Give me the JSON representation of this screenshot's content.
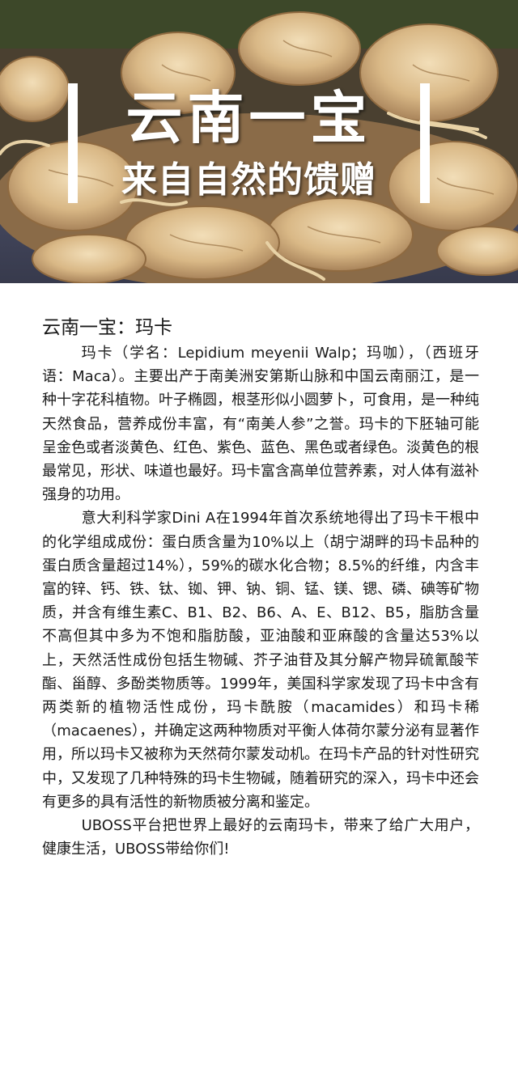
{
  "hero": {
    "image_alt": "maca-roots-photo",
    "banner_line1": "云南一宝",
    "banner_line2": "来自自然的馈赠"
  },
  "article": {
    "title": "云南一宝：玛卡",
    "paragraphs": [
      "玛卡（学名：Lepidium meyenii Walp；玛咖），（西班牙语：Maca）。主要出产于南美洲安第斯山脉和中国云南丽江，是一种十字花科植物。叶子椭圆，根茎形似小圆萝卜，可食用，是一种纯天然食品，营养成份丰富，有“南美人参”之誉。玛卡的下胚轴可能呈金色或者淡黄色、红色、紫色、蓝色、黑色或者绿色。淡黄色的根最常见，形状、味道也最好。玛卡富含高单位营养素，对人体有滋补强身的功用。",
      "意大利科学家Dini A在1994年首次系统地得出了玛卡干根中的化学组成成份：蛋白质含量为10%以上（胡宁湖畔的玛卡品种的蛋白质含量超过14%），59%的碳水化合物；8.5%的纤维，内含丰富的锌、钙、铁、钛、铷、钾、钠、铜、锰、镁、锶、磷、碘等矿物质，并含有维生素C、B1、B2、B6、A、E、B12、B5，脂肪含量不高但其中多为不饱和脂肪酸，亚油酸和亚麻酸的含量达53%以上，天然活性成份包括生物碱、芥子油苷及其分解产物异硫氰酸苄酯、甾醇、多酚类物质等。1999年，美国科学家发现了玛卡中含有两类新的植物活性成份，玛卡酰胺（macamides）和玛卡稀（macaenes），并确定这两种物质对平衡人体荷尔蒙分泌有显著作用，所以玛卡又被称为天然荷尔蒙发动机。在玛卡产品的针对性研究中，又发现了几种特殊的玛卡生物碱，随着研究的深入，玛卡中还会有更多的具有活性的新物质被分离和鉴定。",
      "UBOSS平台把世界上最好的云南玛卡，带来了给广大用户，健康生活，UBOSS带给你们!"
    ]
  }
}
